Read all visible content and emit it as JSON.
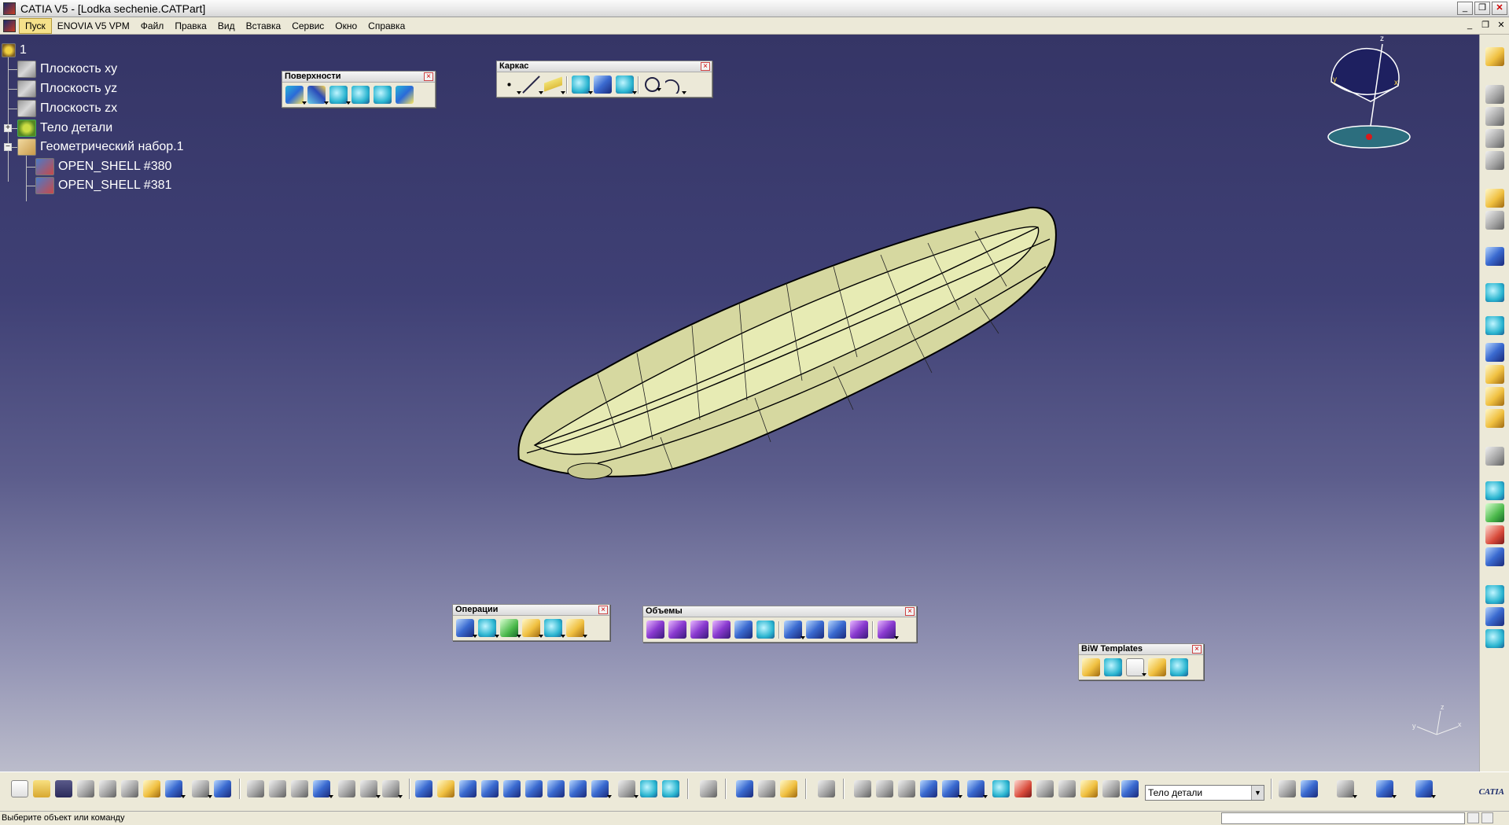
{
  "window": {
    "title": "CATIA V5 - [Lodka sechenie.CATPart]",
    "buttons": [
      "_",
      "❐",
      "✕"
    ]
  },
  "menu": {
    "items": [
      "Пуск",
      "ENOVIA V5 VPM",
      "Файл",
      "Правка",
      "Вид",
      "Вставка",
      "Сервис",
      "Окно",
      "Справка"
    ],
    "active": "Пуск"
  },
  "tree": {
    "root": "1",
    "nodes": [
      "Плоскость xy",
      "Плоскость yz",
      "Плоскость zx",
      "Тело детали",
      "Геометрический набор.1",
      "OPEN_SHELL #380",
      "OPEN_SHELL #381"
    ]
  },
  "toolbars": {
    "surfaces": {
      "title": "Поверхности"
    },
    "wireframe": {
      "title": "Каркас"
    },
    "operations": {
      "title": "Операции"
    },
    "volumes": {
      "title": "Объемы"
    },
    "biw": {
      "title": "BiW Templates"
    }
  },
  "compass": {
    "x": "x",
    "y": "y",
    "z": "z"
  },
  "triad": {
    "x": "x",
    "y": "y",
    "z": "z"
  },
  "bottom": {
    "current_body": "Тело детали"
  },
  "status": {
    "message": "Выберите объект или команду"
  },
  "logo": {
    "text": "CATIA"
  },
  "colors": {
    "viewport_top": "#353566",
    "viewport_bottom": "#bbbccb",
    "hull_fill": "#d6d8a0",
    "hull_edge": "#000000"
  }
}
